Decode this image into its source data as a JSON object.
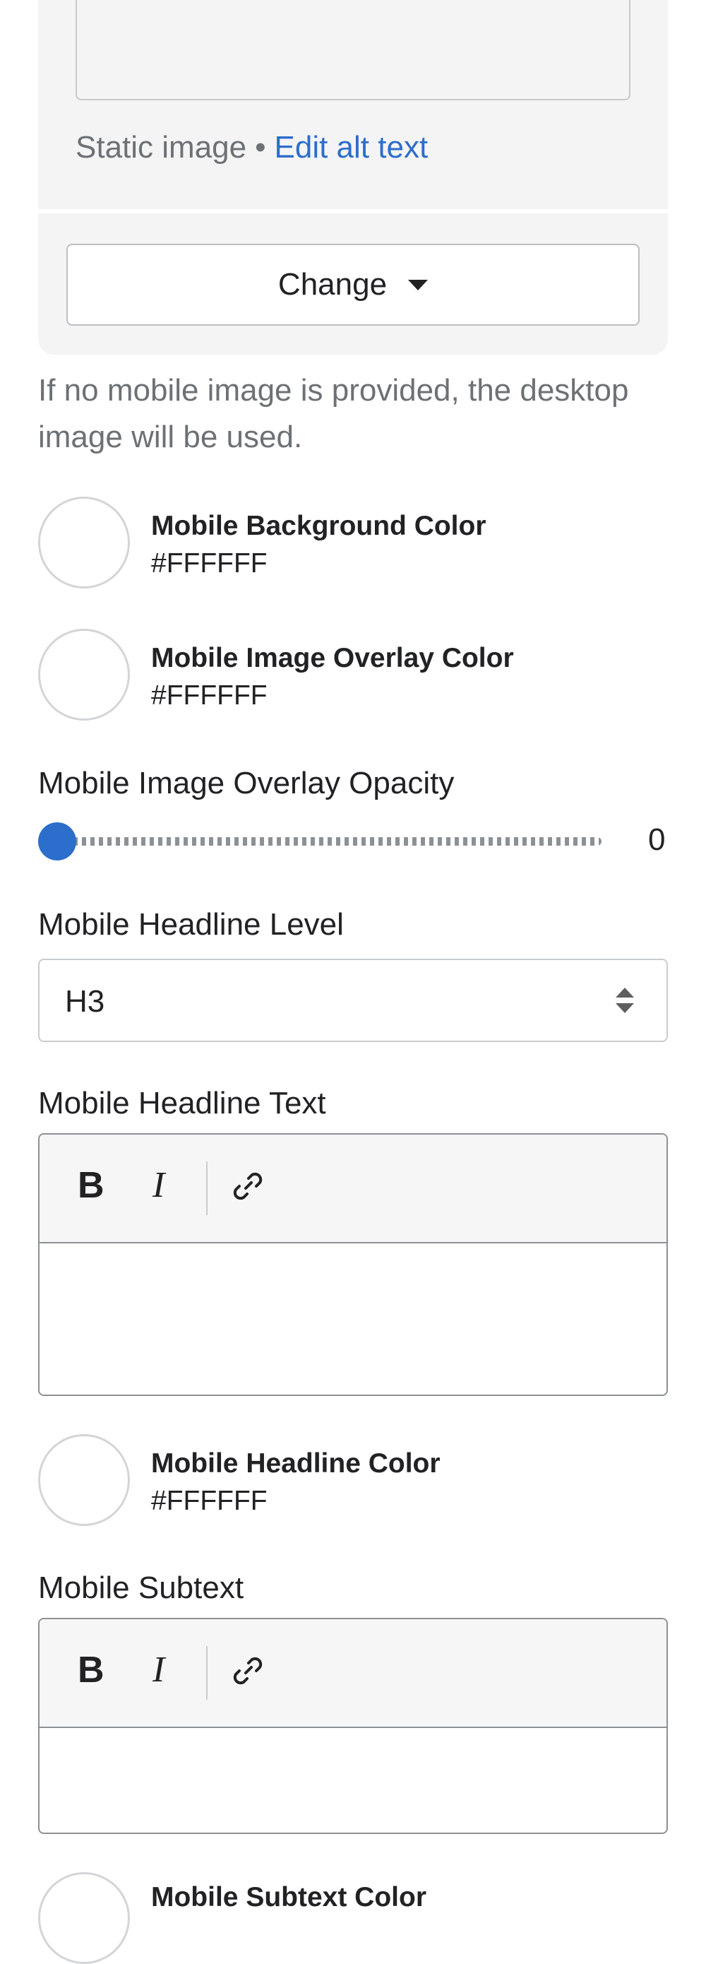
{
  "image_card": {
    "status": "Static image",
    "separator": "•",
    "edit_alt_link": "Edit alt text",
    "change_button": "Change"
  },
  "help_text": "If no mobile image is provided, the desktop image will be used.",
  "colors": {
    "mobile_background": {
      "label": "Mobile Background Color",
      "value": "#FFFFFF"
    },
    "mobile_overlay": {
      "label": "Mobile Image Overlay Color",
      "value": "#FFFFFF"
    },
    "mobile_headline": {
      "label": "Mobile Headline Color",
      "value": "#FFFFFF"
    },
    "mobile_subtext": {
      "label": "Mobile Subtext Color"
    }
  },
  "opacity": {
    "label": "Mobile Image Overlay Opacity",
    "value": "0"
  },
  "headline_level": {
    "label": "Mobile Headline Level",
    "selected": "H3"
  },
  "headline_text": {
    "label": "Mobile Headline Text",
    "toolbar": {
      "bold": "B",
      "italic": "I"
    }
  },
  "subtext": {
    "label": "Mobile Subtext",
    "toolbar": {
      "bold": "B",
      "italic": "I"
    }
  },
  "theme": {
    "accent": "#2C6ECB",
    "swatch_fill": "#FFFFFF"
  }
}
